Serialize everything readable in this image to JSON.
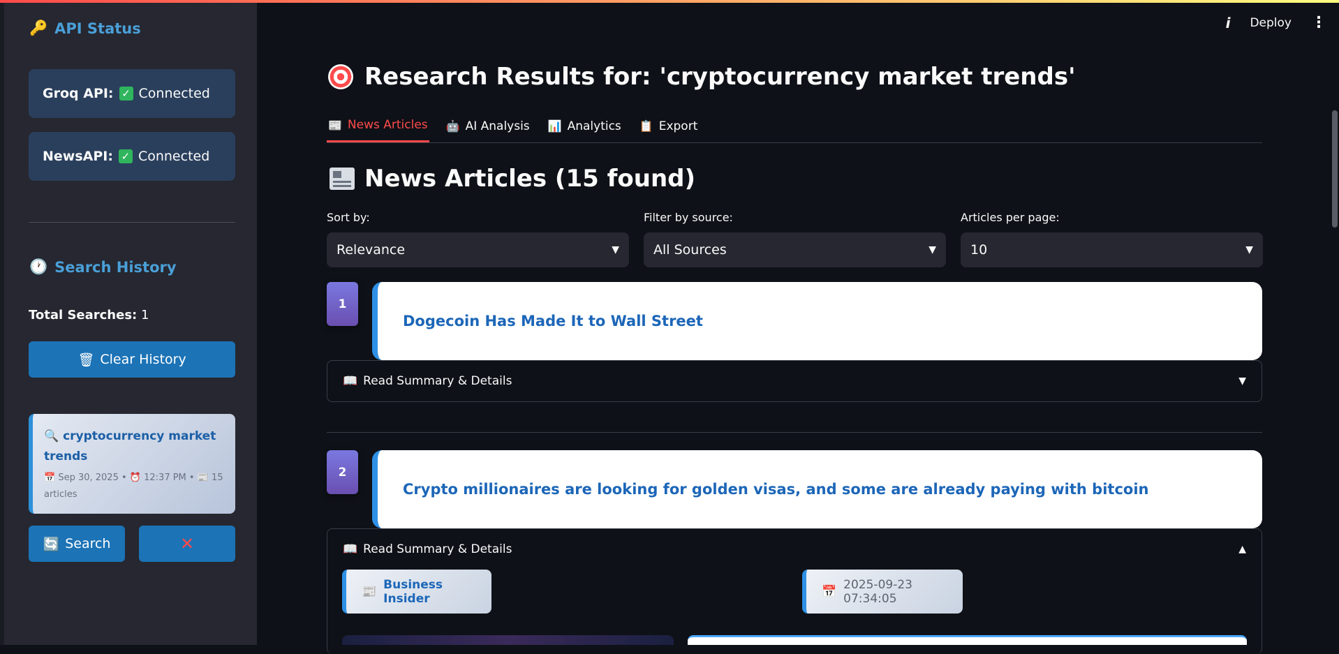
{
  "sidebar": {
    "api_status_heading": "API Status",
    "groq": {
      "label": "Groq API:",
      "status": "Connected"
    },
    "newsapi": {
      "label": "NewsAPI:",
      "status": "Connected"
    },
    "search_history_heading": "Search History",
    "total_label": "Total Searches:",
    "total_value": "1",
    "clear_history_label": "Clear History",
    "history": [
      {
        "query": "cryptocurrency market trends",
        "date": "Sep 30, 2025",
        "time": "12:37 PM",
        "count": "15 articles"
      }
    ],
    "search_button": "Search",
    "delete_glyph": "✕"
  },
  "header": {
    "deploy_label": "Deploy"
  },
  "main": {
    "title": "Research Results for: 'cryptocurrency market trends'",
    "tabs": [
      {
        "label": "News Articles",
        "active": true
      },
      {
        "label": "AI Analysis"
      },
      {
        "label": "Analytics"
      },
      {
        "label": "Export"
      }
    ],
    "section_title": "News Articles (15 found)",
    "filters": {
      "sort": {
        "label": "Sort by:",
        "value": "Relevance"
      },
      "source": {
        "label": "Filter by source:",
        "value": "All Sources"
      },
      "per_page": {
        "label": "Articles per page:",
        "value": "10"
      }
    },
    "articles": [
      {
        "number": "1",
        "title": "Dogecoin Has Made It to Wall Street",
        "expander": "Read Summary & Details",
        "expanded": false
      },
      {
        "number": "2",
        "title": "Crypto millionaires are looking for golden visas, and some are already paying with bitcoin",
        "expander": "Read Summary & Details",
        "expanded": true,
        "source": "Business Insider",
        "published": "2025-09-23 07:34:05"
      }
    ]
  },
  "colors": {
    "accent": "#ff4b4b",
    "link": "#1c66b8",
    "sidebar_heading": "#4a9fd8",
    "button": "#1c73b6"
  }
}
